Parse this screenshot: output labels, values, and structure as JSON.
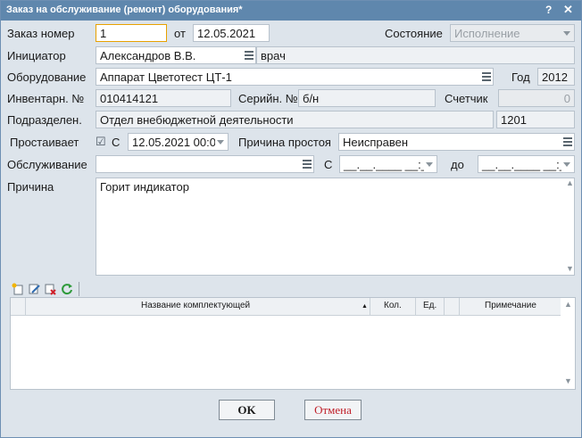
{
  "window": {
    "title": "Заказ на обслуживание (ремонт) оборудования*",
    "help": "?",
    "close": "✕"
  },
  "form": {
    "order_number_label": "Заказ номер",
    "order_number": "1",
    "from_label": "от",
    "order_date": "12.05.2021",
    "state_label": "Состояние",
    "state_value": "Исполнение",
    "initiator_label": "Инициатор",
    "initiator": "Александров В.В.",
    "initiator_role": "врач",
    "equipment_label": "Оборудование",
    "equipment": "Аппарат Цветотест ЦТ-1",
    "year_label": "Год",
    "year": "2012",
    "inventory_label": "Инвентарн. №",
    "inventory": "010414121",
    "serial_label": "Серийн. №",
    "serial": "б/н",
    "counter_label": "Счетчик",
    "counter": "0",
    "department_label": "Подразделен.",
    "department": "Отдел внебюджетной деятельности",
    "department_code": "1201",
    "idle_label": "Простаивает",
    "idle_check": "☑",
    "idle_from_label": "С",
    "idle_from": "12.05.2021 00:0",
    "idle_reason_label": "Причина простоя",
    "idle_reason": "Неисправен",
    "service_label": "Обслуживание",
    "service": "",
    "service_from_label": "С",
    "service_from": "__.__.____ __:_",
    "service_to_label": "до",
    "service_to": "__.__.____ __:_",
    "reason_label": "Причина",
    "reason": "Горит индикатор"
  },
  "table": {
    "columns": [
      "Название комплектующей",
      "Кол.",
      "Ед.",
      "Примечание"
    ],
    "rows": []
  },
  "buttons": {
    "ok": "OK",
    "cancel": "Отмена"
  },
  "colors": {
    "title_bar": "#5f87ad",
    "window_bg": "#dde4eb",
    "cancel_text": "#c0202a",
    "focus_border": "#e8a100"
  }
}
